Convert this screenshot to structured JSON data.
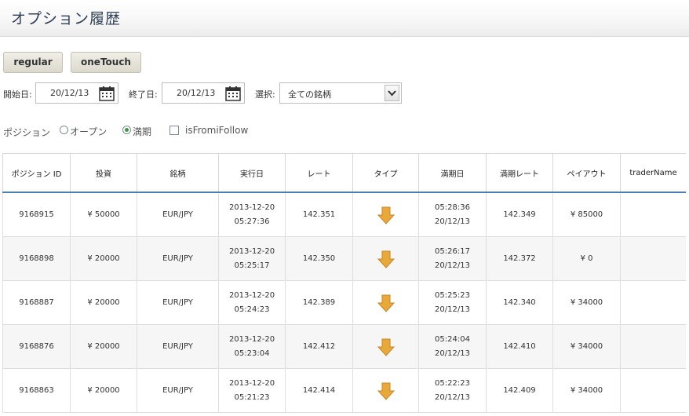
{
  "page": {
    "title": "オプション履歴"
  },
  "tabs": {
    "regular": "regular",
    "onetouch": "oneTouch"
  },
  "filters": {
    "start_label": "開始日:",
    "start_value": "20/12/13",
    "end_label": "終了日:",
    "end_value": "20/12/13",
    "select_label": "選択:",
    "select_value": "全ての銘柄"
  },
  "position": {
    "label": "ポジション",
    "open_label": "オープン",
    "expired_label": "満期",
    "selected": "expired",
    "follow_label": "isFromiFollow",
    "follow_checked": false
  },
  "table": {
    "headers": [
      "ポジション ID",
      "投資",
      "銘柄",
      "実行日",
      "レート",
      "タイプ",
      "満期日",
      "満期レート",
      "ペイアウト",
      "traderName"
    ],
    "rows": [
      {
        "id": "9168915",
        "invest": "¥ 50000",
        "symbol": "EUR/JPY",
        "exec_date": "2013-12-20",
        "exec_time": "05:27:36",
        "rate": "142.351",
        "type": "down-arrow-icon",
        "exp_time": "05:28:36",
        "exp_date": "20/12/13",
        "exp_rate": "142.349",
        "payout": "¥ 85000",
        "trader": ""
      },
      {
        "id": "9168898",
        "invest": "¥ 20000",
        "symbol": "EUR/JPY",
        "exec_date": "2013-12-20",
        "exec_time": "05:25:17",
        "rate": "142.350",
        "type": "down-arrow-icon",
        "exp_time": "05:26:17",
        "exp_date": "20/12/13",
        "exp_rate": "142.372",
        "payout": "¥ 0",
        "trader": ""
      },
      {
        "id": "9168887",
        "invest": "¥ 20000",
        "symbol": "EUR/JPY",
        "exec_date": "2013-12-20",
        "exec_time": "05:24:23",
        "rate": "142.389",
        "type": "down-arrow-icon",
        "exp_time": "05:25:23",
        "exp_date": "20/12/13",
        "exp_rate": "142.340",
        "payout": "¥ 34000",
        "trader": ""
      },
      {
        "id": "9168876",
        "invest": "¥ 20000",
        "symbol": "EUR/JPY",
        "exec_date": "2013-12-20",
        "exec_time": "05:23:04",
        "rate": "142.412",
        "type": "down-arrow-icon",
        "exp_time": "05:24:04",
        "exp_date": "20/12/13",
        "exp_rate": "142.410",
        "payout": "¥ 34000",
        "trader": ""
      },
      {
        "id": "9168863",
        "invest": "¥ 20000",
        "symbol": "EUR/JPY",
        "exec_date": "2013-12-20",
        "exec_time": "05:21:23",
        "rate": "142.414",
        "type": "down-arrow-icon",
        "exp_time": "05:22:23",
        "exp_date": "20/12/13",
        "exp_rate": "142.409",
        "payout": "¥ 34000",
        "trader": ""
      }
    ]
  },
  "colors": {
    "header_rule": "#4a7fb5",
    "arrow": "#e8a93a",
    "radio_selected": "#3a9a3a",
    "title": "#2e4057"
  }
}
